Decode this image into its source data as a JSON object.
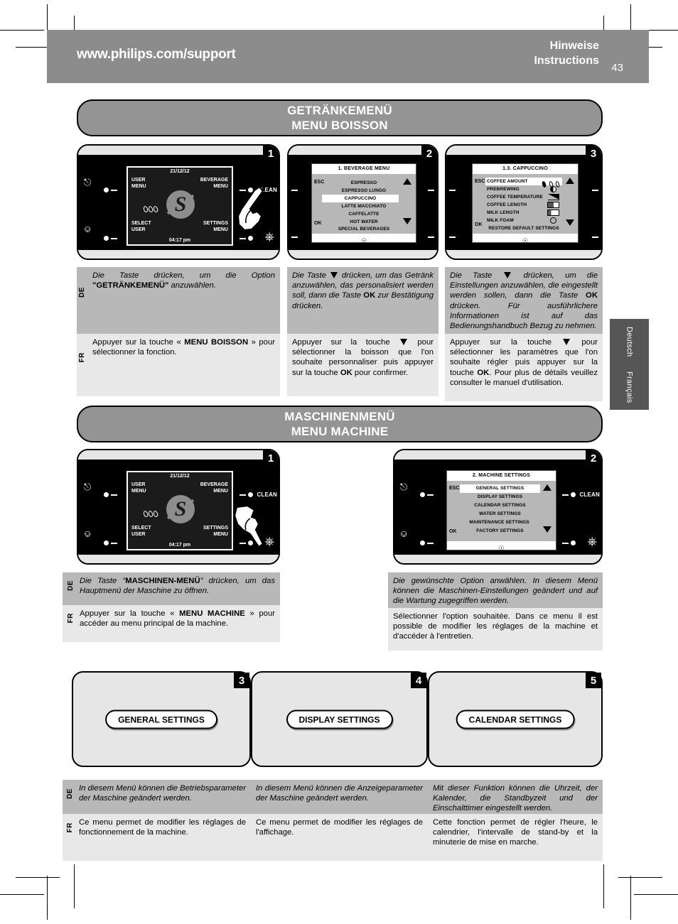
{
  "header": {
    "url": "www.philips.com/support",
    "line1": "Hinweise",
    "line2": "Instructions",
    "page": "43"
  },
  "sections": [
    {
      "title_de": "GETRÄNKEMENÜ",
      "title_fr": "MENU BOISSON"
    },
    {
      "title_de": "MASCHINENMENÜ",
      "title_fr": "MENU MACHINE"
    }
  ],
  "machine_ui": {
    "clean_label": "CLEAN",
    "esc": "ESC",
    "ok": "OK"
  },
  "panels": {
    "p1": {
      "number": "1",
      "screen": {
        "date": "21/12/12",
        "time": "04:17 pm",
        "top_left": [
          "USER",
          "MENU"
        ],
        "top_right": [
          "BEVERAGE",
          "MENU"
        ],
        "bottom_left": [
          "SELECT",
          "USER"
        ],
        "bottom_right": [
          "SETTINGS",
          "MENU"
        ]
      }
    },
    "p2": {
      "number": "2",
      "screen": {
        "title": "1. BEVERAGE MENU",
        "items": [
          "ESPRESSO",
          "ESPRESSO LUNGO",
          "CAPPUCCINO",
          "LATTE MACCHIATO",
          "CAFFELATTE",
          "HOT WATER",
          "SPECIAL BEVERAGES"
        ],
        "selected_index": 2
      }
    },
    "p3": {
      "number": "3",
      "screen": {
        "title": "1.3. CAPPUCCINO",
        "items": [
          "COFFEE AMOUNT",
          "PREBREWING",
          "COFFEE TEMPERATURE",
          "COFFEE LENGTH",
          "MILK  LENGTH",
          "MILK FOAM",
          "RESTORE DEFAULT SETTINGS"
        ],
        "selected_index": 0
      }
    },
    "m1": {
      "number": "1",
      "screen": {
        "date": "21/12/12",
        "time": "04:17 pm",
        "top_left": [
          "USER",
          "MENU"
        ],
        "top_right": [
          "BEVERAGE",
          "MENU"
        ],
        "bottom_left": [
          "SELECT",
          "USER"
        ],
        "bottom_right": [
          "SETTINGS",
          "MENU"
        ]
      }
    },
    "m2": {
      "number": "2",
      "screen": {
        "title": "2. MACHINE SETTINGS",
        "items": [
          "GENERAL SETTINGS",
          "DISPLAY SETTINGS",
          "CALENDAR SETTINGS",
          "WATER SETTINGS",
          "MAINTENANCE SETTINGS",
          "FACTORY SETTINGS"
        ],
        "selected_index": 0
      }
    }
  },
  "captions": {
    "c1": {
      "de_pre": "Die Taste drücken, um die Option ",
      "de_bold": "\"GETRÄNKEMENÜ\"",
      "de_post": " anzuwählen.",
      "fr_pre": "Appuyer sur la touche « ",
      "fr_bold": "MENU BOISSON",
      "fr_post": " » pour sélectionner la fonction."
    },
    "c2": {
      "de_a": "Die Taste ",
      "de_b": " drücken, um das Getränk anzuwählen, das personalisiert werden soll, dann die Taste ",
      "de_ok": "OK",
      "de_c": " zur Bestätigung drücken.",
      "fr_a": "Appuyer sur la touche ",
      "fr_b": " pour sélectionner la boisson que l'on souhaite personnaliser puis appuyer sur la touche ",
      "fr_ok": "OK",
      "fr_c": " pour confirmer."
    },
    "c3": {
      "de_a": "Die Taste ",
      "de_b": " drücken, um die Einstellungen anzuwählen, die eingestellt werden sollen, dann die Taste ",
      "de_ok": "OK",
      "de_c": " drücken. Für ausführlichere Informationen ist auf das Bedienungshandbuch Bezug zu nehmen.",
      "fr_a": "Appuyer sur la touche ",
      "fr_b": " pour sélectionner les paramètres que l'on souhaite régler puis appuyer sur la touche ",
      "fr_ok": "OK",
      "fr_c": ". Pour plus de détails veuillez consulter le manuel d'utilisation."
    },
    "m1": {
      "de_pre": "Die Taste “",
      "de_bold": "MASCHINEN-MENÜ",
      "de_post": "” drücken, um das Hauptmenü der Maschine zu öffnen.",
      "fr_pre": "Appuyer sur la touche « ",
      "fr_bold": "MENU MACHINE",
      "fr_post": " » pour accéder au menu principal de la machine."
    },
    "m2": {
      "de": "Die gewünschte Option anwählen. In diesem Menü können die Maschinen-Einstellungen geändert und auf die Wartung zugegriffen werden.",
      "fr": "Sélectionner l'option souhaitée. Dans ce menu il est possible de modifier les réglages de la machine et d'accéder à l'entretien."
    },
    "b3": {
      "de": "In diesem Menü können die Betriebsparameter der Maschine geändert werden.",
      "fr": "Ce menu permet de modifier les réglages de fonctionnement de la machine."
    },
    "b4": {
      "de": "In diesem Menü können die Anzeigeparameter der Maschine geändert werden.",
      "fr": "Ce menu permet de modifier les réglages de l'affichage."
    },
    "b5": {
      "de": "Mit dieser Funktion können die Uhrzeit, der Kalender, die Standbyzeit und der Einschalttimer eingestellt werden.",
      "fr": "Cette fonction permet de régler l'heure, le calendrier, l'intervalle de stand-by et la minuterie de mise en marche."
    }
  },
  "bottom_panels": [
    {
      "number": "3",
      "label": "GENERAL SETTINGS"
    },
    {
      "number": "4",
      "label": "DISPLAY SETTINGS"
    },
    {
      "number": "5",
      "label": "CALENDAR SETTINGS"
    }
  ],
  "lang_tags": {
    "de": "DE",
    "fr": "FR"
  },
  "side_tabs": [
    {
      "label": "Deutsch"
    },
    {
      "label": "Français"
    }
  ],
  "colors": {
    "banner_gray": "#8c8c8c",
    "pill_gray": "#949494",
    "de_block": "#b8b8b8",
    "fr_block": "#e8e8e8",
    "panel_fill": "#e6e6e6",
    "side_tab": "#565656"
  }
}
